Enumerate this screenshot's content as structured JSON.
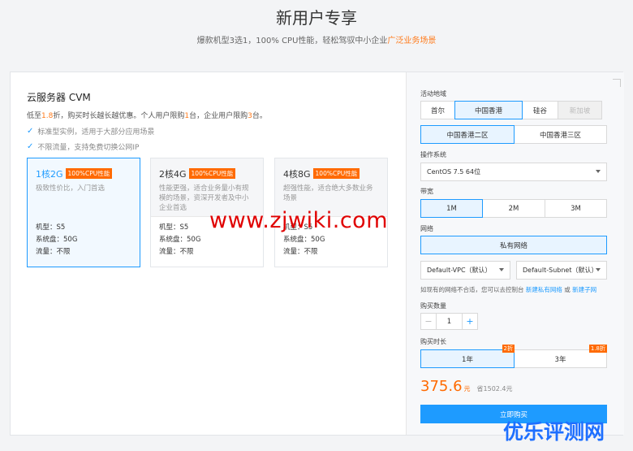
{
  "hero": {
    "title": "新用户专享",
    "subtitle_main": "爆款机型3选1，100% CPU性能，轻松驾驭中小企业",
    "subtitle_highlight": "广泛业务场景"
  },
  "product": {
    "title": "云服务器 CVM",
    "promo_1": "低至",
    "promo_discount": "1.8",
    "promo_2": "折，购买时长越长越优惠。个人用户限购",
    "promo_personal": "1",
    "promo_3": "台，企业用户限购",
    "promo_enterprise": "3",
    "promo_4": "台。",
    "features": [
      "标准型实例，适用于大部分应用场景",
      "不限流量，支持免费切换公网IP"
    ]
  },
  "plans": [
    {
      "name": "1核2G",
      "badge": "100%CPU性能",
      "desc": "极致性价比，入门首选",
      "model": "机型：S5",
      "disk": "系统盘：50G",
      "traffic": "流量：不限",
      "selected": true
    },
    {
      "name": "2核4G",
      "badge": "100%CPU性能",
      "desc": "性能更强，适合业务量小有规模的场景，资深开发者及中小企业首选",
      "model": "机型：S5",
      "disk": "系统盘：50G",
      "traffic": "流量：不限",
      "selected": false
    },
    {
      "name": "4核8G",
      "badge": "100%CPU性能",
      "desc": "超强性能，适合绝大多数业务场景",
      "model": "机型：S5",
      "disk": "系统盘：50G",
      "traffic": "流量：不限",
      "selected": false
    }
  ],
  "watermark": "www.zjwiki.com",
  "watermark2": "优乐评测网",
  "config": {
    "region_label": "活动地域",
    "regions": [
      "首尔",
      "中国香港",
      "硅谷",
      "新加坡"
    ],
    "region_selected": "中国香港",
    "zones": [
      "中国香港二区",
      "中国香港三区"
    ],
    "zone_selected": "中国香港二区",
    "os_label": "操作系统",
    "os_value": "CentOS 7.5 64位",
    "bw_label": "带宽",
    "bandwidths": [
      "1M",
      "2M",
      "3M"
    ],
    "bw_selected": "1M",
    "net_label": "网络",
    "net_value": "私有网络",
    "vpc": "Default-VPC（默认）",
    "subnet": "Default-Subnet（默认）",
    "hint_text": "如现有的网络不合适，您可以去控制台",
    "hint_link1": "新建私有网络",
    "hint_or": "或",
    "hint_link2": "新建子网",
    "qty_label": "购买数量",
    "qty_minus": "−",
    "qty_value": "1",
    "qty_plus": "+",
    "dur_label": "购买时长",
    "durations": [
      {
        "label": "1年",
        "tag": "2折"
      },
      {
        "label": "3年",
        "tag": "1.8折"
      }
    ],
    "dur_selected": "1年",
    "price": "375.6",
    "price_unit": "元",
    "save_text": "省1502.4元",
    "buy_label": "立即购买"
  },
  "colors": {
    "accent": "#1e9bff",
    "orange": "#ff6a00",
    "watermark_red": "#e00000"
  }
}
